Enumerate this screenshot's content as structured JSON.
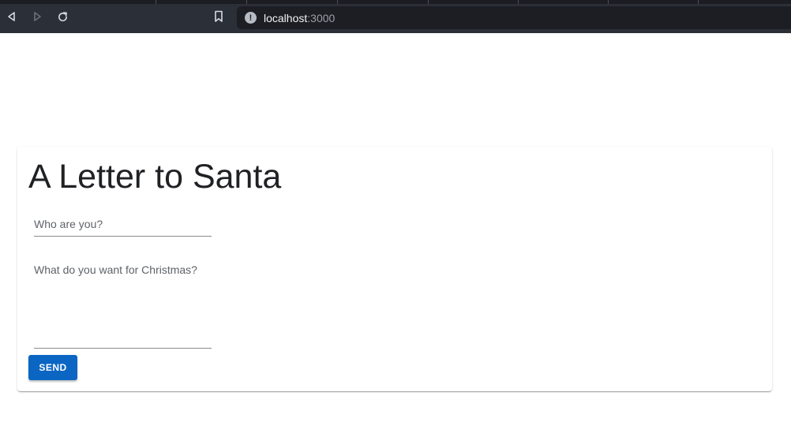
{
  "browser": {
    "url_host": "localhost",
    "url_port": ":3000",
    "info_icon": "info-icon",
    "nav_icons": [
      "back-icon",
      "forward-icon",
      "reload-icon",
      "bookmark-icon"
    ]
  },
  "page": {
    "title": "A Letter to Santa",
    "name_label": "Who are you?",
    "wish_label": "What do you want for Christmas?",
    "send_label": "SEND"
  },
  "colors": {
    "chrome_background": "#2b2f38",
    "urlbar_background": "#1c1e23",
    "button_primary": "#0b66c3",
    "title_text": "#202124"
  }
}
